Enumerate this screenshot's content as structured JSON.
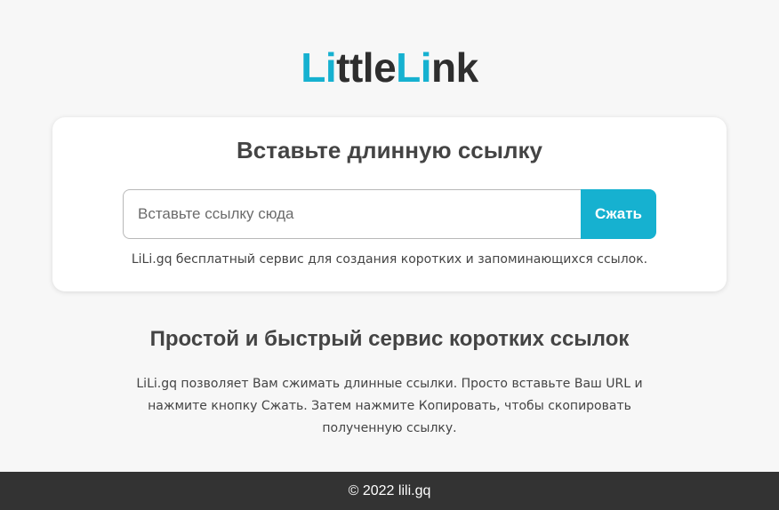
{
  "logo": {
    "part1_accent": "Li",
    "part2": "ttle",
    "part3_accent": "Li",
    "part4": "nk",
    "accent_color": "#16b1d0",
    "dark_color": "#2e2e2e"
  },
  "card": {
    "title": "Вставьте длинную ссылку",
    "input_placeholder": "Вставьте ссылку сюда",
    "input_value": "",
    "button_label": "Сжать",
    "note": "LiLi.gq бесплатный сервис для создания коротких и запоминающихся ссылок."
  },
  "section": {
    "title": "Простой и быстрый сервис коротких ссылок",
    "text": "LiLi.gq позволяет Вам сжимать длинные ссылки. Просто вставьте Ваш URL и нажмите кнопку Сжать. Затем нажмите Копировать, чтобы скопировать полученную ссылку."
  },
  "footer": {
    "copyright": "© 2022 lili.gq"
  }
}
